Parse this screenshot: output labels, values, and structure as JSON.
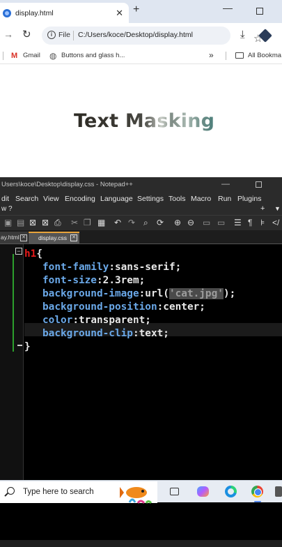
{
  "browser": {
    "tab_title": "display.html",
    "tab_close": "✕",
    "new_tab": "+",
    "window_min": "—",
    "nav_forward": "→",
    "nav_reload": "↻",
    "address_chip": "File",
    "url": "C:/Users/koce/Desktop/display.html",
    "star": "☆",
    "download": "⤓",
    "bookmarks": {
      "gmail_icon": "M",
      "gmail": "Gmail",
      "globe_icon": "◍",
      "buttons": "Buttons and glass h...",
      "more": "»",
      "all": "All Bookma"
    },
    "page_heading": "Text Masking"
  },
  "notepad": {
    "title": "Users\\koce\\Desktop\\display.css - Notepad++",
    "window_min": "—",
    "menu": [
      "dit",
      "Search",
      "View",
      "Encoding",
      "Language",
      "Settings",
      "Tools",
      "Macro",
      "Run",
      "Plugins"
    ],
    "menu_row2": "w   ?",
    "menu_plus": "+",
    "menu_down": "▼",
    "tabs": [
      {
        "label": "ay.html",
        "close": "✕"
      },
      {
        "label": "display.css",
        "close": "✕"
      }
    ],
    "fold_marker": "−",
    "code": {
      "selector": "h1",
      "open_brace": "{",
      "lines": [
        {
          "prop": "font-family",
          "value": "sans-serif;"
        },
        {
          "prop": "font-size",
          "value": "2.3rem;"
        },
        {
          "prop": "background-image",
          "value_pre": "url(",
          "string": "'cat.jpg'",
          "value_post": ");"
        },
        {
          "prop": "background-position",
          "value": "center;"
        },
        {
          "prop": "color",
          "value": "transparent;"
        },
        {
          "prop": "background-clip",
          "value": "text;"
        }
      ],
      "close_brace": "}"
    }
  },
  "taskbar": {
    "search_placeholder": "Type here to search"
  },
  "colors": {
    "css_selector": "#e51b1b",
    "css_property": "#6aa8e8",
    "editor_bg": "#000000",
    "fold_line": "#2ca02c",
    "tab_accent": "#e8a33b"
  }
}
